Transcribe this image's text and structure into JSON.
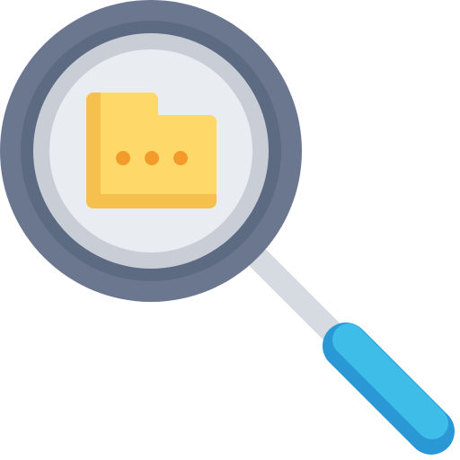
{
  "icon": {
    "name": "magnifier-folder-search-icon",
    "parts": {
      "magnifier_ring": "magnifier-ring-icon",
      "lens": "lens-icon",
      "folder": "folder-icon",
      "ellipsis": "ellipsis-dots-icon",
      "handle": "magnifier-handle-icon"
    },
    "colors": {
      "ring_outer": "#6B778F",
      "ring_inner": "#5C6A82",
      "lens_rim": "#C8CDD6",
      "lens_glass": "#E9ECF1",
      "shaft": "#D6DAE1",
      "handle_light": "#3DBDE8",
      "handle_dark": "#2B98D6",
      "folder_light": "#FED96A",
      "folder_dark": "#F5C04D",
      "dots": "#F29B2A"
    }
  }
}
